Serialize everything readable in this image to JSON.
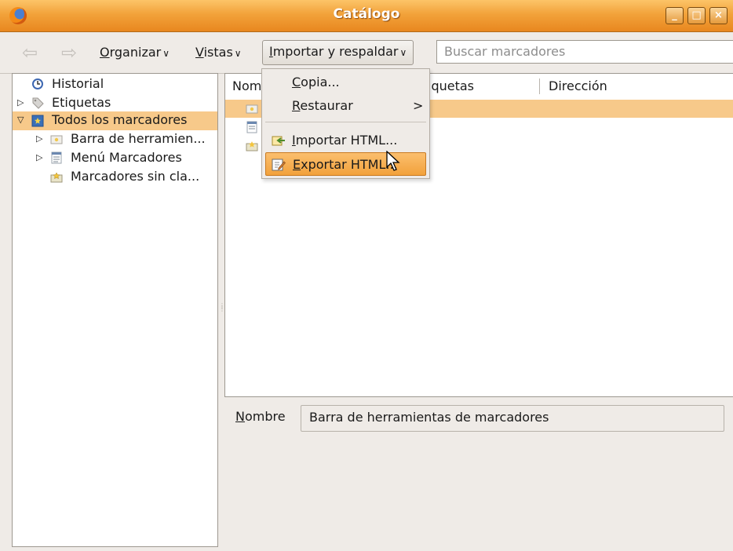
{
  "window": {
    "title": "Catálogo",
    "icon": "firefox-icon",
    "controls": [
      "minimize-icon",
      "maximize-icon",
      "close-icon"
    ]
  },
  "toolbar": {
    "back_icon": "back-arrow-icon",
    "forward_icon": "forward-arrow-icon",
    "organize": {
      "mnemonic": "O",
      "rest": "rganizar"
    },
    "views": {
      "mnemonic": "V",
      "rest": "istas"
    },
    "import_backup": {
      "mnemonic": "I",
      "rest": "mportar y respaldar"
    },
    "search_placeholder": "Buscar marcadores"
  },
  "sidebar": {
    "items": [
      {
        "label": "Historial",
        "icon": "clock-icon"
      },
      {
        "label": "Etiquetas",
        "icon": "tags-icon"
      },
      {
        "label": "Todos los marcadores",
        "icon": "bookmarks-icon",
        "selected": true
      },
      {
        "label": "Barra de herramien...",
        "icon": "bookmarks-toolbar-icon"
      },
      {
        "label": "Menú Marcadores",
        "icon": "bookmarks-menu-icon"
      },
      {
        "label": "Marcadores sin cla...",
        "icon": "unsorted-bookmarks-icon"
      }
    ]
  },
  "table": {
    "columns": [
      "Nom",
      "iquetas",
      "Dirección"
    ]
  },
  "dropdown": {
    "items": [
      {
        "mnemonic": "C",
        "rest": "opia..."
      },
      {
        "mnemonic": "R",
        "rest": "estaurar",
        "submenu_glyph": ">"
      },
      {
        "mnemonic": "I",
        "rest": "mportar HTML...",
        "icon": "import-html-icon"
      },
      {
        "mnemonic": "E",
        "rest": "xportar HTML...",
        "icon": "export-html-icon",
        "highlighted": true
      }
    ]
  },
  "details": {
    "name_label": {
      "mnemonic": "N",
      "rest": "ombre"
    },
    "name_value": "Barra de herramientas de marcadores"
  },
  "colors": {
    "titlebar": "#f2a23a",
    "selection": "#f7c98a",
    "menu_highlight": "#f2a13b"
  }
}
